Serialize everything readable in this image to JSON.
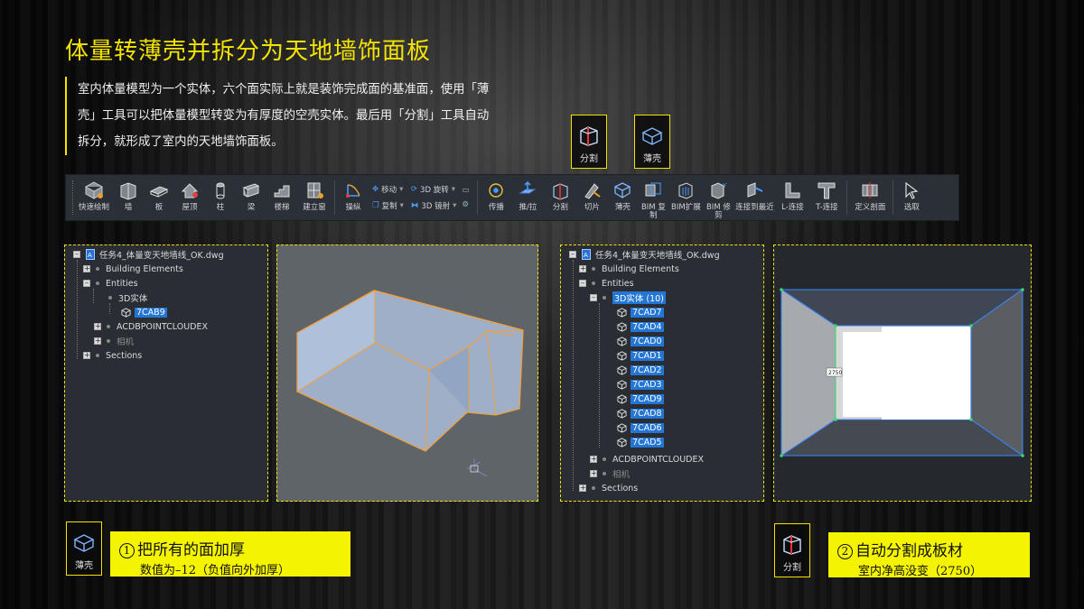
{
  "title": "体量转薄壳并拆分为天地墙饰面板",
  "intro": "室内体量模型为一个实体，六个面实际上就是装饰完成面的基准面，使用「薄壳」工具可以把体量模型转变为有厚度的空壳实体。最后用「分割」工具自动拆分，就形成了室内的天地墙饰面板。",
  "top_icons": {
    "split": "分割",
    "shell": "薄壳"
  },
  "toolbar": {
    "quick_draw": "快速绘制",
    "wall": "墙",
    "slab": "板",
    "roof": "屋顶",
    "column": "柱",
    "beam": "梁",
    "stair": "楼梯",
    "window": "建立窗",
    "manipulator": "操纵",
    "move": "移动",
    "rotate3d": "3D 旋转",
    "copy": "复制",
    "mirror3d": "3D 镜射",
    "propagate": "传播",
    "pushpull": "推/拉",
    "split": "分割",
    "slice": "切片",
    "shell": "薄壳",
    "bim_copy": "BIM 复制",
    "bim_extend": "BIM扩展",
    "bim_update": "BIM 修剪",
    "connect_nearest": "连接到最近",
    "l_connect": "L-连接",
    "t_connect": "T-连接",
    "define_section": "定义剖面",
    "select": "选取"
  },
  "left_tree": {
    "file": "任务4_体量变天地墙线_OK.dwg",
    "building": "Building Elements",
    "entities": "Entities",
    "solid": "3D实体",
    "item": "7CAB9",
    "pointcloud": "ACDBPOINTCLOUDEX",
    "camera": "相机",
    "sections": "Sections"
  },
  "right_tree": {
    "file": "任务4_体量变天地墙线_OK.dwg",
    "building": "Building Elements",
    "entities": "Entities",
    "solid": "3D实体 (10)",
    "items": [
      "7CAD7",
      "7CAD4",
      "7CAD0",
      "7CAD1",
      "7CAD2",
      "7CAD3",
      "7CAD9",
      "7CAD8",
      "7CAD6",
      "7CAD5"
    ],
    "pointcloud": "ACDBPOINTCLOUDEX",
    "camera": "相机",
    "sections": "Sections"
  },
  "dimension": "2750",
  "step1": {
    "icon_label": "薄壳",
    "line1": "把所有的面加厚",
    "line2": "数值为–12（负值向外加厚）",
    "num": "1"
  },
  "step2": {
    "icon_label": "分割",
    "line1": "自动分割成板材",
    "line2": "室内净高没变（2750）",
    "num": "2"
  },
  "colors": {
    "accent": "#f4e300",
    "highlight": "#2376d3",
    "model_edge": "#f0a040",
    "model_face": "#a9bcd8"
  }
}
